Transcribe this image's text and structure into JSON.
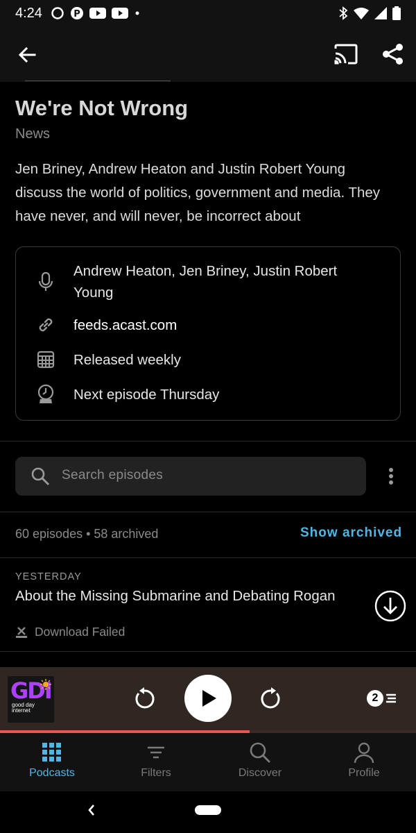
{
  "status_bar": {
    "time": "4:24"
  },
  "podcast": {
    "title": "We're Not Wrong",
    "category": "News",
    "description": "Jen Briney, Andrew Heaton and Justin Robert Young discuss the world of politics, government and media. They have never, and will never, be incorrect about"
  },
  "info": {
    "authors": "Andrew Heaton, Jen Briney, Justin Robert Young",
    "website": "feeds.acast.com",
    "schedule": "Released weekly",
    "next_episode": "Next episode Thursday"
  },
  "search": {
    "placeholder": "Search episodes"
  },
  "episodes_summary": {
    "count": "60 episodes • 58 archived",
    "show_archived_label": "Show archived"
  },
  "episode": {
    "date": "YESTERDAY",
    "title": "About the Missing Submarine and Debating Rogan",
    "status": "Download Failed"
  },
  "player": {
    "artwork_text": "GDI",
    "artwork_subtext": "good day internet",
    "queue_count": "2",
    "progress": 0.6
  },
  "nav": {
    "podcasts": "Podcasts",
    "filters": "Filters",
    "discover": "Discover",
    "profile": "Profile"
  },
  "colors": {
    "accent": "#4db8e6",
    "progress": "#e55a4f",
    "player_bg": "#302622"
  }
}
